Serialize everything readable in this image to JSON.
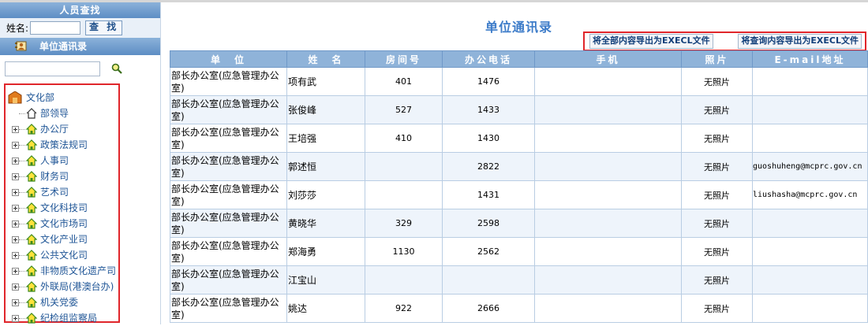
{
  "left_panel": {
    "header": "人员查找",
    "search_label": "姓名:",
    "search_value": "",
    "search_button": "查 找",
    "sub_header": "单位通讯录",
    "filter_value": "",
    "tree": {
      "root": "文化部",
      "items": [
        {
          "label": "部领导",
          "expandable": false,
          "icon": "home-outline-icon"
        },
        {
          "label": "办公厅",
          "expandable": true,
          "icon": "house-icon"
        },
        {
          "label": "政策法规司",
          "expandable": true,
          "icon": "house-icon"
        },
        {
          "label": "人事司",
          "expandable": true,
          "icon": "house-icon"
        },
        {
          "label": "财务司",
          "expandable": true,
          "icon": "house-icon"
        },
        {
          "label": "艺术司",
          "expandable": true,
          "icon": "house-icon"
        },
        {
          "label": "文化科技司",
          "expandable": true,
          "icon": "house-icon"
        },
        {
          "label": "文化市场司",
          "expandable": true,
          "icon": "house-icon"
        },
        {
          "label": "文化产业司",
          "expandable": true,
          "icon": "house-icon"
        },
        {
          "label": "公共文化司",
          "expandable": true,
          "icon": "house-icon"
        },
        {
          "label": "非物质文化遗产司",
          "expandable": true,
          "icon": "house-icon"
        },
        {
          "label": "外联局(港澳台办)",
          "expandable": true,
          "icon": "house-icon"
        },
        {
          "label": "机关党委",
          "expandable": true,
          "icon": "house-icon"
        },
        {
          "label": "纪检组监察局",
          "expandable": true,
          "icon": "house-icon"
        }
      ]
    }
  },
  "main": {
    "title": "单位通讯录",
    "export_all": "将全部内容导出为EXECL文件",
    "export_query": "将查询内容导出为EXECL文件",
    "columns": [
      "单　位",
      "姓　名",
      "房间号",
      "办公电话",
      "手机",
      "照片",
      "E-mail地址"
    ],
    "rows": [
      {
        "unit": "部长办公室(应急管理办公室)",
        "name": "项有武",
        "room": "401",
        "phone": "1476",
        "mobile": "",
        "photo": "无照片",
        "email": ""
      },
      {
        "unit": "部长办公室(应急管理办公室)",
        "name": "张俊峰",
        "room": "527",
        "phone": "1433",
        "mobile": "",
        "photo": "无照片",
        "email": ""
      },
      {
        "unit": "部长办公室(应急管理办公室)",
        "name": "王培强",
        "room": "410",
        "phone": "1430",
        "mobile": "",
        "photo": "无照片",
        "email": ""
      },
      {
        "unit": "部长办公室(应急管理办公室)",
        "name": "郭述恒",
        "room": "",
        "phone": "2822",
        "mobile": "",
        "photo": "无照片",
        "email": "guoshuheng@mcprc.gov.cn"
      },
      {
        "unit": "部长办公室(应急管理办公室)",
        "name": "刘莎莎",
        "room": "",
        "phone": "1431",
        "mobile": "",
        "photo": "无照片",
        "email": "liushasha@mcprc.gov.cn"
      },
      {
        "unit": "部长办公室(应急管理办公室)",
        "name": "黄晓华",
        "room": "329",
        "phone": "2598",
        "mobile": "",
        "photo": "无照片",
        "email": ""
      },
      {
        "unit": "部长办公室(应急管理办公室)",
        "name": "郑海勇",
        "room": "1130",
        "phone": "2562",
        "mobile": "",
        "photo": "无照片",
        "email": ""
      },
      {
        "unit": "部长办公室(应急管理办公室)",
        "name": "江宝山",
        "room": "",
        "phone": "",
        "mobile": "",
        "photo": "无照片",
        "email": ""
      },
      {
        "unit": "部长办公室(应急管理办公室)",
        "name": "姚达",
        "room": "922",
        "phone": "2666",
        "mobile": "",
        "photo": "无照片",
        "email": ""
      }
    ]
  },
  "colors": {
    "header_blue": "#8fb3d9",
    "title_blue": "#3d7cc9",
    "link_blue": "#1f5596",
    "highlight_red": "#e0262b",
    "row_alt": "#eef4fb"
  }
}
